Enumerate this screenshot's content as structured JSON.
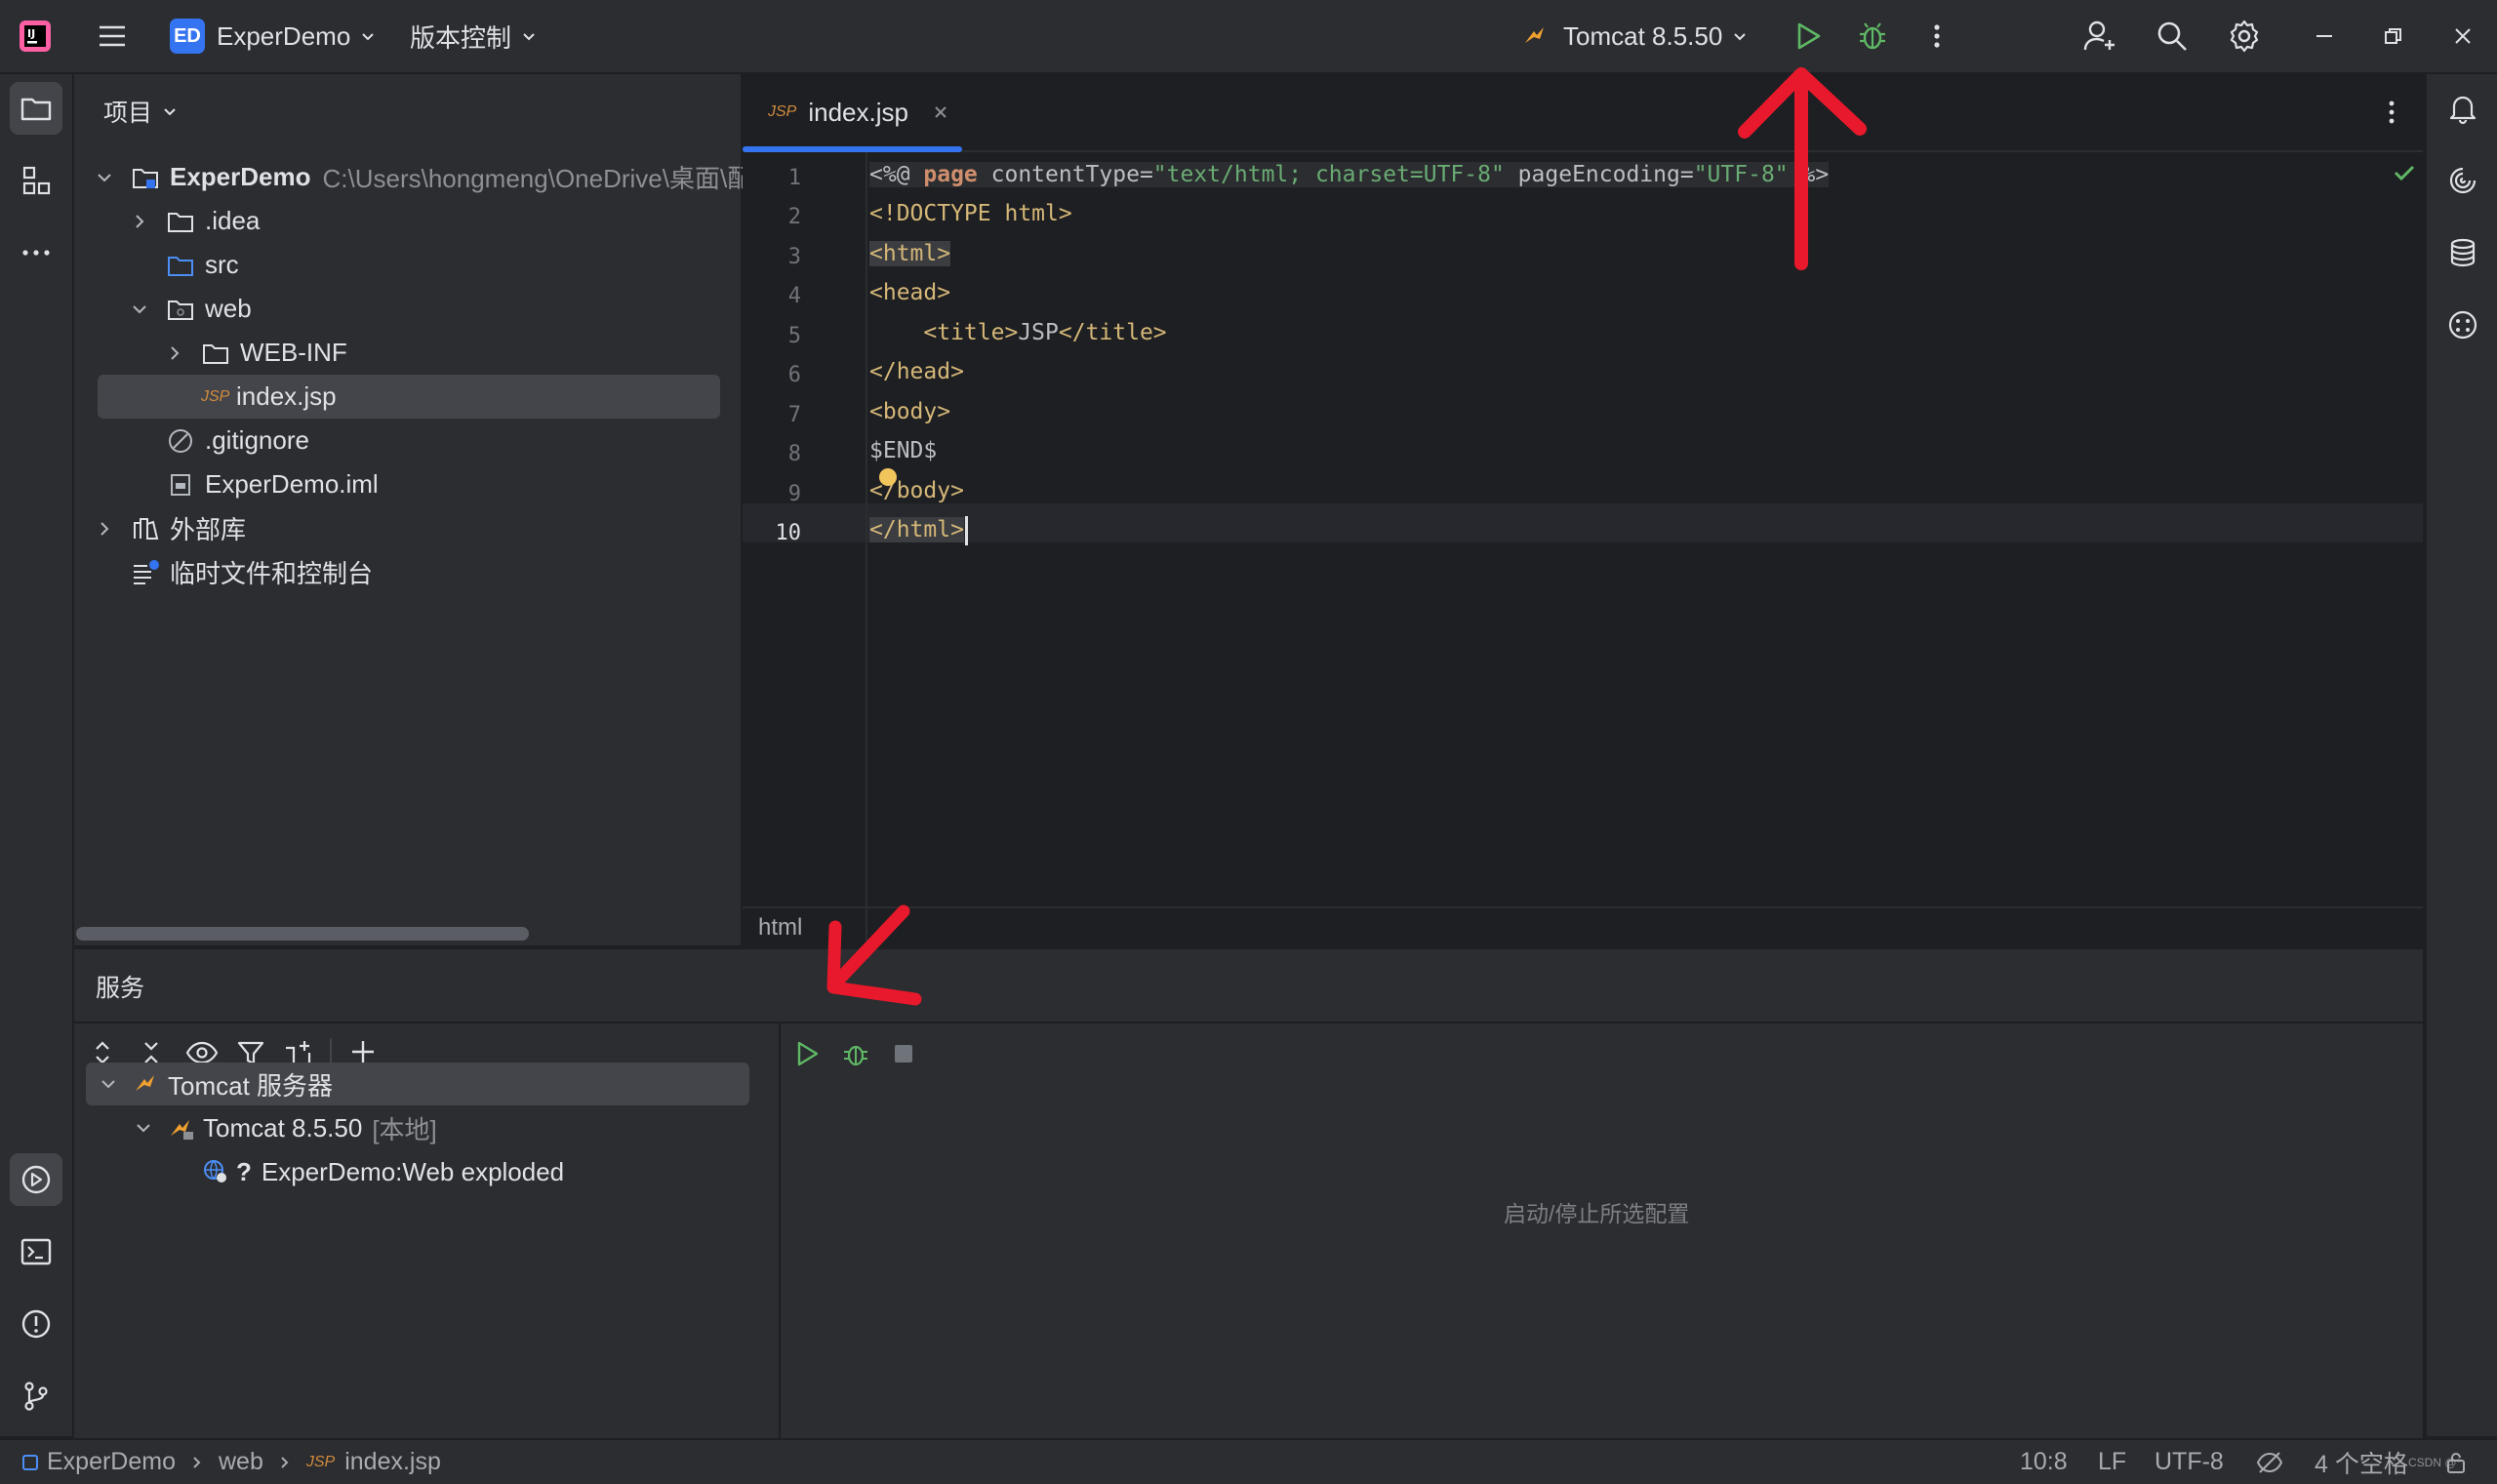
{
  "titlebar": {
    "project_badge": "ED",
    "project_name": "ExperDemo",
    "vcs_label": "版本控制",
    "run_config": "Tomcat 8.5.50"
  },
  "project_panel": {
    "title": "项目",
    "tree": [
      {
        "label": "ExperDemo",
        "path": "C:\\Users\\hongmeng\\OneDrive\\桌面\\配"
      },
      {
        "label": ".idea"
      },
      {
        "label": "src"
      },
      {
        "label": "web"
      },
      {
        "label": "WEB-INF"
      },
      {
        "label": "index.jsp"
      },
      {
        "label": ".gitignore"
      },
      {
        "label": "ExperDemo.iml"
      },
      {
        "label": "外部库"
      },
      {
        "label": "临时文件和控制台"
      }
    ]
  },
  "editor": {
    "tab_badge": "JSP",
    "tab_label": "index.jsp",
    "line_numbers": [
      "1",
      "2",
      "3",
      "4",
      "5",
      "6",
      "7",
      "8",
      "9",
      "10"
    ],
    "breadcrumb": "html",
    "code": {
      "l1_a": "<%@ ",
      "l1_b": "page",
      "l1_c": " contentType=",
      "l1_d": "\"text/html; charset=UTF-8\"",
      "l1_e": " pageEncoding=",
      "l1_f": "\"UTF-8\"",
      "l1_g": " %>",
      "l2": "<!DOCTYPE html>",
      "l3": "<html>",
      "l4": "<head>",
      "l5_a": "    <title>",
      "l5_b": "JSP",
      "l5_c": "</title>",
      "l6": "</head>",
      "l7": "<body>",
      "l8": "$END$",
      "l9": "</body>",
      "l10": "</html>"
    }
  },
  "services": {
    "title": "服务",
    "tree": [
      {
        "label": "Tomcat 服务器"
      },
      {
        "label": "Tomcat 8.5.50",
        "suffix": "[本地]"
      },
      {
        "label": "ExperDemo:Web exploded",
        "prefix": "?"
      }
    ],
    "empty_hint": "启动/停止所选配置"
  },
  "statusbar": {
    "crumbs": [
      "ExperDemo",
      "web",
      "index.jsp"
    ],
    "crumb_badge": "JSP",
    "position": "10:8",
    "line_sep": "LF",
    "encoding": "UTF-8",
    "indent": "4 个空格",
    "watermark": "CSDN @*"
  },
  "colors": {
    "accent": "#3574f0",
    "run_green": "#5fb865",
    "annotation_red": "#e8192c"
  }
}
